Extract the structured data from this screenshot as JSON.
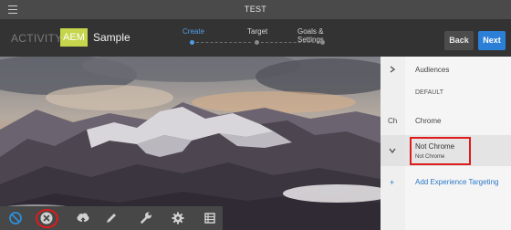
{
  "window": {
    "title": "TEST"
  },
  "header": {
    "activity_label": "ACTIVITY:",
    "logo_text": "AEM",
    "activity_name": "Sample",
    "steps": [
      {
        "label": "Create",
        "active": true
      },
      {
        "label": "Target",
        "active": false
      },
      {
        "label": "Goals & Settings",
        "active": false
      }
    ],
    "back_label": "Back",
    "next_label": "Next"
  },
  "colors": {
    "accent": "#2c7fd7",
    "logo": "#c5d54c",
    "highlight": "#e01b1b"
  },
  "toolbar": {
    "tools": [
      "block-icon",
      "close-circle-icon",
      "cloud-upload-icon",
      "pencil-icon",
      "wrench-icon",
      "gear-icon",
      "list-icon"
    ]
  },
  "panel": {
    "audiences_label": "Audiences",
    "default_label": "DEFAULT",
    "chrome_abbrev": "Ch",
    "chrome_label": "Chrome",
    "not_chrome_label": "Not Chrome",
    "not_chrome_sub": "Not Chrome",
    "add_targeting_label": "Add Experience Targeting",
    "add_symbol": "+"
  }
}
